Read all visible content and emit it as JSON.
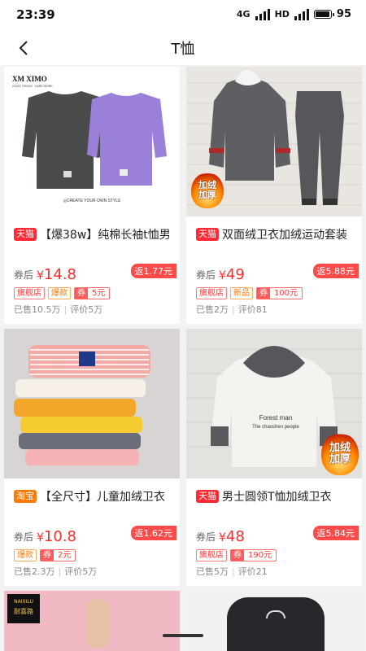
{
  "status": {
    "time": "23:39",
    "network": "4G",
    "hd": "HD",
    "battery": "95",
    "battery_level": 0.95
  },
  "nav": {
    "title": "T恤",
    "back_icon": "chevron-left-icon"
  },
  "labels": {
    "after_coupon": "券后",
    "price_prefix": "¥",
    "coupon_prefix": "券"
  },
  "products": [
    {
      "platform": "天猫",
      "platform_type": "tmall",
      "title": "【爆38w】纯棉长袖t恤男",
      "price": "14.8",
      "rebate": "返1.77元",
      "tags": [
        "旗舰店",
        "爆款"
      ],
      "coupon": "5元",
      "sold": "已售10.5万",
      "reviews": "评价5万",
      "image": {
        "logo": "XM XIMO",
        "logo_sub": "GOOD THINGS · HARD WORK",
        "caption": "◎CREATE YOUR OWN STYLE"
      }
    },
    {
      "platform": "天猫",
      "platform_type": "tmall",
      "title": "双面绒卫衣加绒运动套装",
      "price": "49",
      "rebate": "返5.88元",
      "tags": [
        "旗舰店",
        "新品"
      ],
      "coupon": "100元",
      "sold": "已售2万",
      "reviews": "评价81",
      "image": {
        "badge": [
          "加绒",
          "加厚"
        ]
      }
    },
    {
      "platform": "淘宝",
      "platform_type": "taobao",
      "title": "【全尺寸】儿童加绒卫衣",
      "price": "10.8",
      "rebate": "返1.62元",
      "tags": [
        "爆款"
      ],
      "coupon": "2元",
      "sold": "已售2.3万",
      "reviews": "评价5万",
      "image": {}
    },
    {
      "platform": "天猫",
      "platform_type": "tmall",
      "title": "男士圆领T恤加绒卫衣",
      "price": "48",
      "rebate": "返5.84元",
      "tags": [
        "旗舰店"
      ],
      "coupon": "190元",
      "sold": "已售5万",
      "reviews": "评价21",
      "image": {
        "print_text": "Forest man",
        "print_sub": "The chaoshen people",
        "badge": [
          "加绒",
          "加厚"
        ]
      }
    }
  ],
  "partial_row": {
    "left_brand": "NAIXILU",
    "left_brand_cn": "耐喜路"
  }
}
